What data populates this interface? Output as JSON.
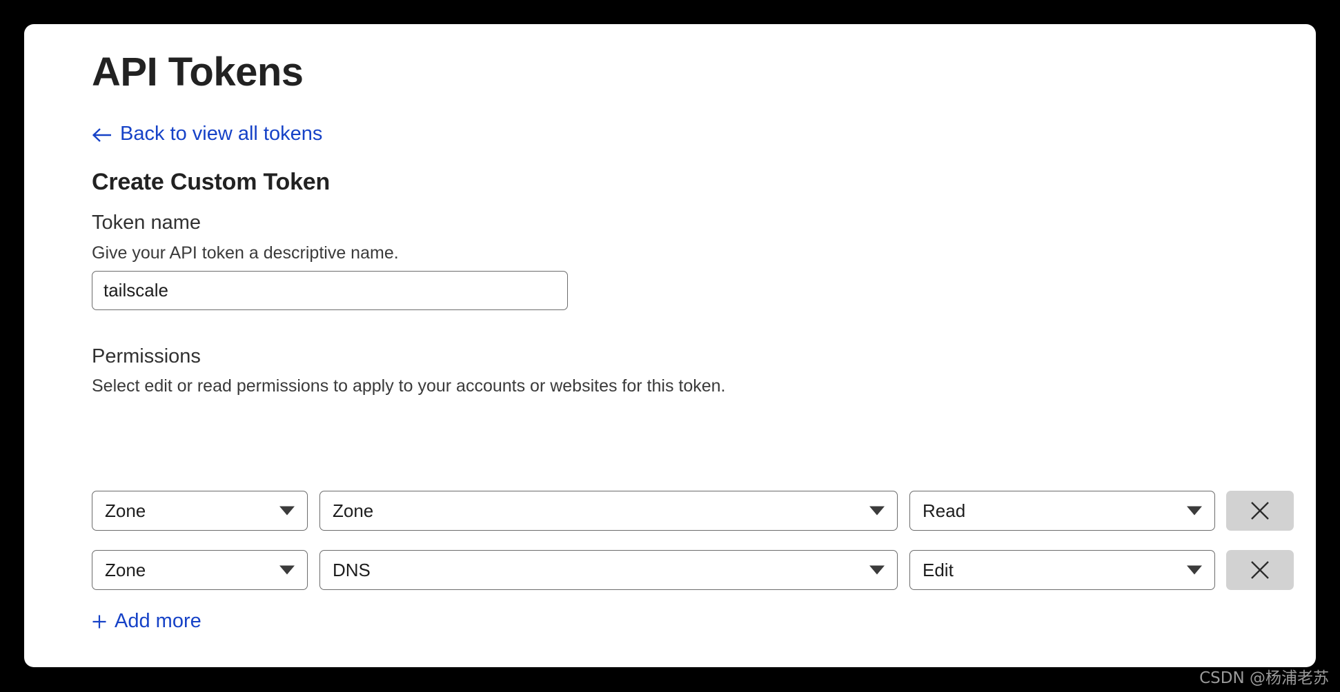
{
  "page": {
    "title": "API Tokens",
    "back_link": "Back to view all tokens",
    "back_icon": "arrow-left-icon"
  },
  "form": {
    "section_title": "Create Custom Token",
    "token_name": {
      "label": "Token name",
      "help": "Give your API token a descriptive name.",
      "value": "tailscale",
      "placeholder": ""
    },
    "permissions": {
      "label": "Permissions",
      "help": "Select edit or read permissions to apply to your accounts or websites for this token.",
      "rows": [
        {
          "resource": "Zone",
          "scope": "Zone",
          "level": "Read",
          "remove_icon": "close-icon"
        },
        {
          "resource": "Zone",
          "scope": "DNS",
          "level": "Edit",
          "remove_icon": "close-icon"
        }
      ],
      "add_more": "Add more",
      "add_more_icon": "plus-icon"
    }
  },
  "watermark": {
    "text": "CSDN @杨浦老苏"
  },
  "colors": {
    "link": "#1642c7",
    "text": "#222222",
    "border": "#6b6b6b",
    "remove_bg": "#d2d2d2"
  }
}
